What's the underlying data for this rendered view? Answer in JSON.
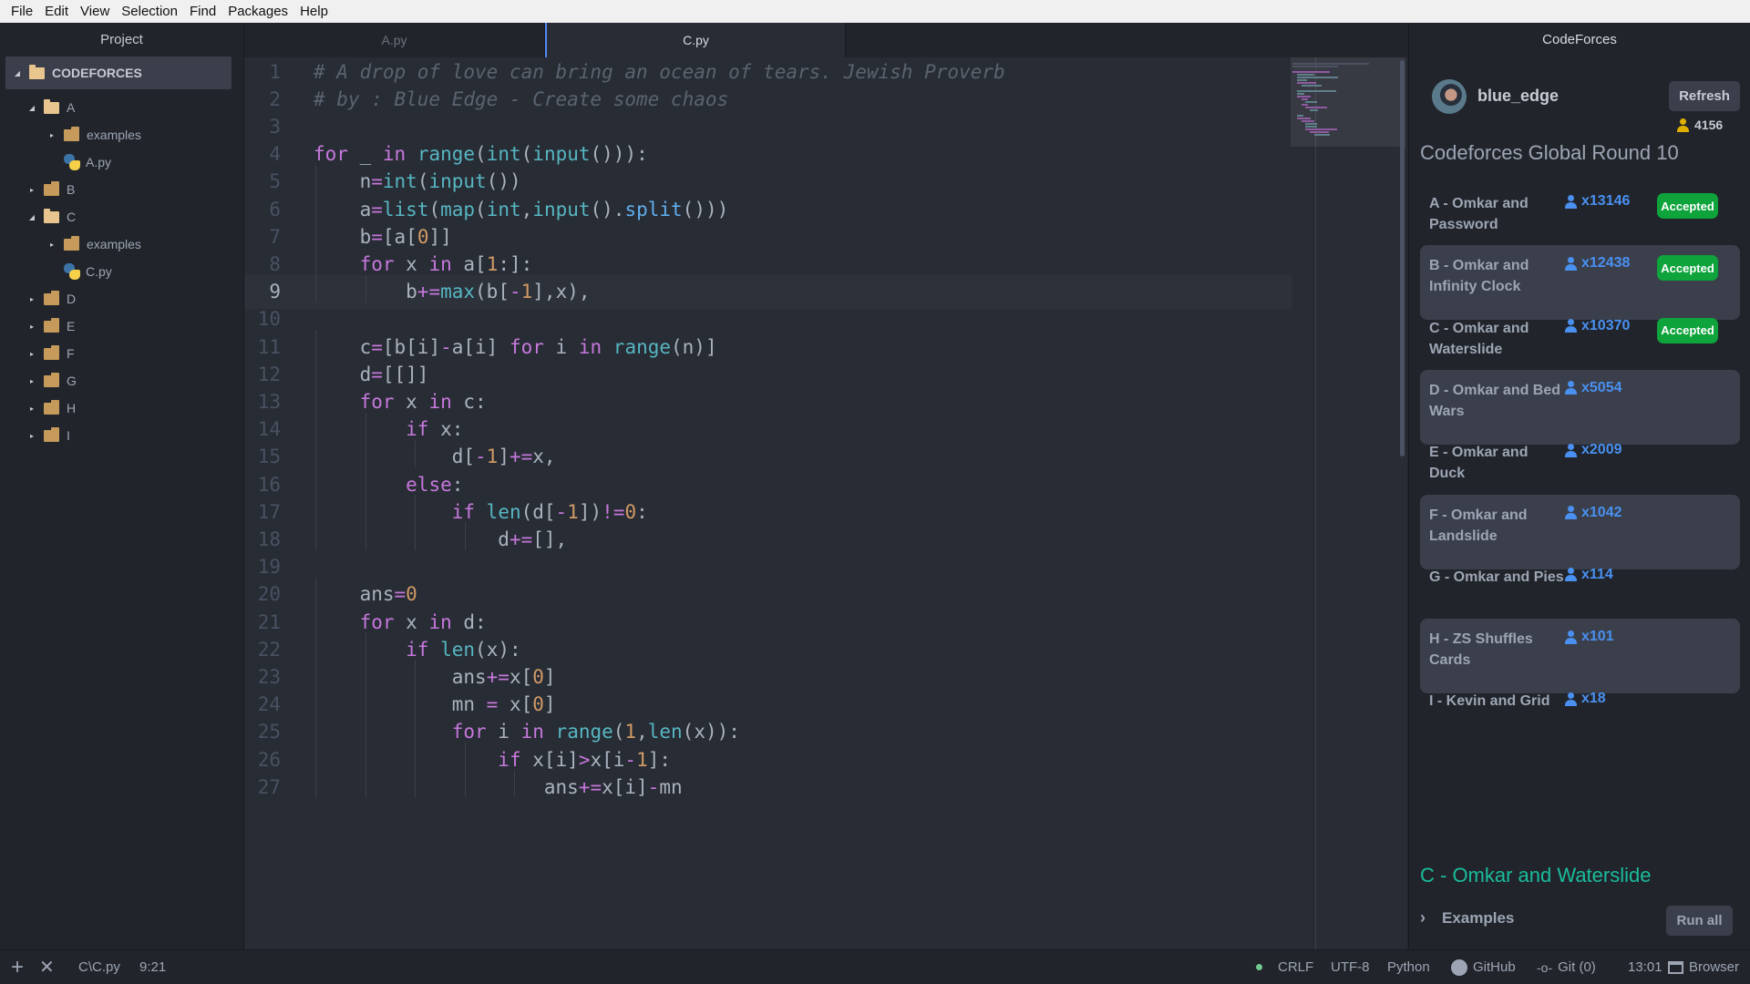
{
  "menu": [
    "File",
    "Edit",
    "View",
    "Selection",
    "Find",
    "Packages",
    "Help"
  ],
  "tree": {
    "title": "Project",
    "root": "CODEFORCES",
    "items": [
      {
        "label": "A",
        "depth": 1,
        "type": "folder",
        "open": true
      },
      {
        "label": "examples",
        "depth": 2,
        "type": "folder",
        "open": false
      },
      {
        "label": "A.py",
        "depth": 2,
        "type": "python"
      },
      {
        "label": "B",
        "depth": 1,
        "type": "folder",
        "open": false
      },
      {
        "label": "C",
        "depth": 1,
        "type": "folder",
        "open": true
      },
      {
        "label": "examples",
        "depth": 2,
        "type": "folder",
        "open": false
      },
      {
        "label": "C.py",
        "depth": 2,
        "type": "python"
      },
      {
        "label": "D",
        "depth": 1,
        "type": "folder",
        "open": false
      },
      {
        "label": "E",
        "depth": 1,
        "type": "folder",
        "open": false
      },
      {
        "label": "F",
        "depth": 1,
        "type": "folder",
        "open": false
      },
      {
        "label": "G",
        "depth": 1,
        "type": "folder",
        "open": false
      },
      {
        "label": "H",
        "depth": 1,
        "type": "folder",
        "open": false
      },
      {
        "label": "I",
        "depth": 1,
        "type": "folder",
        "open": false
      }
    ]
  },
  "tabs": [
    {
      "label": "A.py",
      "active": false
    },
    {
      "label": "C.py",
      "active": true
    }
  ],
  "editor": {
    "current_line": 9,
    "lines": [
      "# A drop of love can bring an ocean of tears. Jewish Proverb",
      "# by : Blue Edge - Create some chaos",
      "",
      "for _ in range(int(input())):",
      "    n=int(input())",
      "    a=list(map(int,input().split()))",
      "    b=[a[0]]",
      "    for x in a[1:]:",
      "        b+=max(b[-1],x),",
      "",
      "    c=[b[i]-a[i] for i in range(n)]",
      "    d=[[]]",
      "    for x in c:",
      "        if x:",
      "            d[-1]+=x,",
      "        else:",
      "            if len(d[-1])!=0:",
      "                d+=[],",
      "",
      "    ans=0",
      "    for x in d:",
      "        if len(x):",
      "            ans+=x[0]",
      "            mn = x[0]",
      "            for i in range(1,len(x)):",
      "                if x[i]>x[i-1]:",
      "                    ans+=x[i]-mn"
    ]
  },
  "codeforces": {
    "title": "CodeForces",
    "username": "blue_edge",
    "refresh_label": "Refresh",
    "rating": "4156",
    "contest": "Codeforces Global Round 10",
    "problems": [
      {
        "name": "A - Omkar and Password",
        "solved": "x13146",
        "verdict": "Accepted"
      },
      {
        "name": "B - Omkar and Infinity Clock",
        "solved": "x12438",
        "verdict": "Accepted"
      },
      {
        "name": "C - Omkar and Waterslide",
        "solved": "x10370",
        "verdict": "Accepted"
      },
      {
        "name": "D - Omkar and Bed Wars",
        "solved": "x5054",
        "verdict": ""
      },
      {
        "name": "E - Omkar and Duck",
        "solved": "x2009",
        "verdict": ""
      },
      {
        "name": "F - Omkar and Landslide",
        "solved": "x1042",
        "verdict": ""
      },
      {
        "name": "G - Omkar and Pies",
        "solved": "x114",
        "verdict": ""
      },
      {
        "name": "H - ZS Shuffles Cards",
        "solved": "x101",
        "verdict": ""
      },
      {
        "name": "I - Kevin and Grid",
        "solved": "x18",
        "verdict": ""
      }
    ],
    "selected_problem": "C - Omkar and Waterslide",
    "examples_label": "Examples",
    "run_all_label": "Run all"
  },
  "status": {
    "path": "C\\C.py",
    "cursor": "9:21",
    "line_ending": "CRLF",
    "encoding": "UTF-8",
    "grammar": "Python",
    "github": "GitHub",
    "git": "Git (0)",
    "time": "13:01",
    "browser": "Browser"
  },
  "colors": {
    "accent": "#568af2",
    "accepted": "#0ea33b",
    "solved_count": "#4a90f0",
    "selected_problem": "#1abc9c"
  }
}
